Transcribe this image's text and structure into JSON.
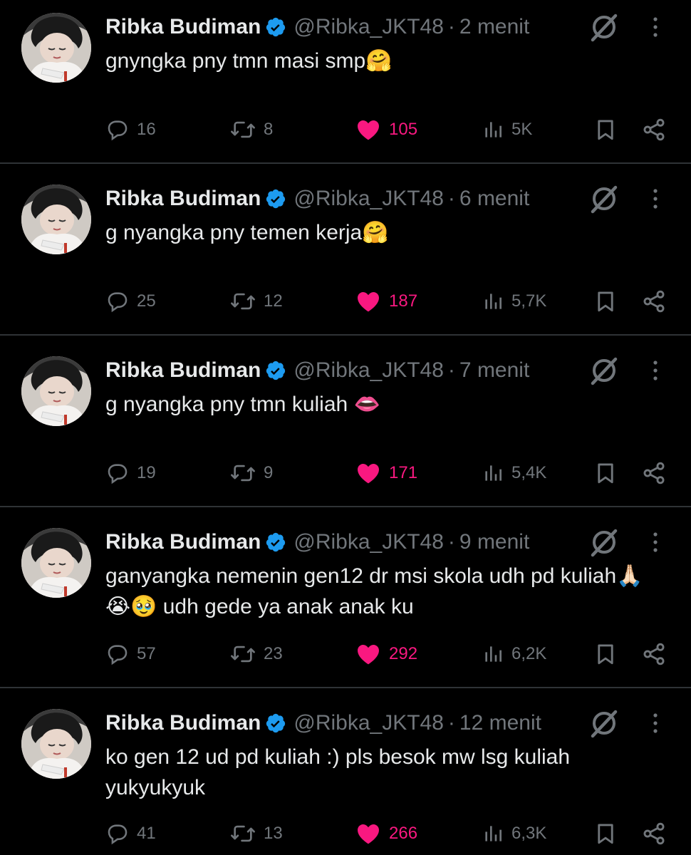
{
  "author": {
    "name": "Ribka Budiman",
    "handle": "@Ribka_JKT48",
    "verified_color": "#1d9bf0"
  },
  "colors": {
    "background": "#000000",
    "text": "#e7e9ea",
    "muted": "#71767b",
    "like": "#f91880",
    "divider": "#2f3336"
  },
  "tweets": [
    {
      "time": "2 menit",
      "lines": [
        "gnyngka pny tmn masi smp🤗"
      ],
      "replies": "16",
      "retweets": "8",
      "likes": "105",
      "views": "5K"
    },
    {
      "time": "6 menit",
      "lines": [
        "g nyangka pny temen kerja🤗"
      ],
      "replies": "25",
      "retweets": "12",
      "likes": "187",
      "views": "5,7K"
    },
    {
      "time": "7 menit",
      "lines": [
        "g nyangka pny tmn kuliah 👄"
      ],
      "replies": "19",
      "retweets": "9",
      "likes": "171",
      "views": "5,4K"
    },
    {
      "time": "9 menit",
      "lines": [
        "ganyangka nemenin gen12 dr msi skola udh pd kuliah🙏🏻",
        "😭🥹 udh gede ya anak anak ku"
      ],
      "replies": "57",
      "retweets": "23",
      "likes": "292",
      "views": "6,2K"
    },
    {
      "time": "12 menit",
      "lines": [
        "ko gen 12 ud pd kuliah :) pls besok mw lsg kuliah",
        "yukyukyuk"
      ],
      "replies": "41",
      "retweets": "13",
      "likes": "266",
      "views": "6,3K"
    }
  ],
  "icons": {
    "reply": "reply-icon",
    "retweet": "retweet-icon",
    "like": "heart-icon",
    "views": "views-icon",
    "bookmark": "bookmark-icon",
    "share": "share-icon",
    "grok": "grok-icon",
    "more": "more-vertical-icon",
    "verified": "verified-badge-icon"
  }
}
